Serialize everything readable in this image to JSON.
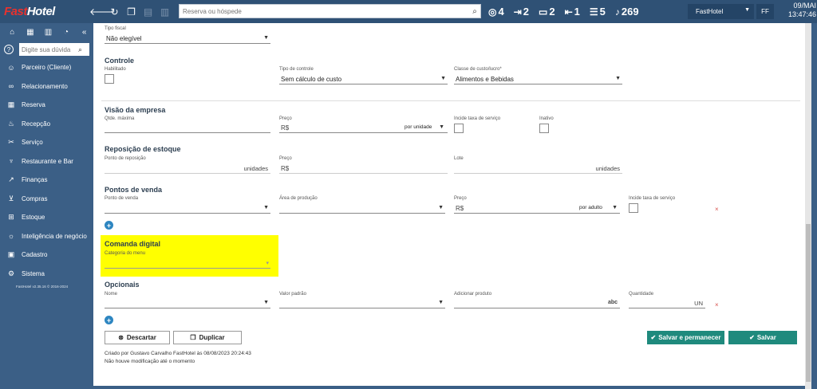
{
  "app": {
    "logo_part1": "Fast",
    "logo_part2": "Hotel"
  },
  "topbar": {
    "search_placeholder": "Reserva ou hóspede",
    "stats": [
      {
        "icon": "target-icon",
        "glyph": "◎",
        "value": "4"
      },
      {
        "icon": "check-in-icon",
        "glyph": "⇥",
        "value": "2"
      },
      {
        "icon": "bed-icon",
        "glyph": "▭",
        "value": "2"
      },
      {
        "icon": "check-out-icon",
        "glyph": "⇤",
        "value": "1"
      },
      {
        "icon": "list-icon",
        "glyph": "☰",
        "value": "5"
      },
      {
        "icon": "bell-icon",
        "glyph": "♪",
        "value": "269"
      }
    ],
    "hotel": "FastHotel",
    "user_initials": "FF",
    "date": "09/MAI",
    "time": "13:47:46"
  },
  "sidebar": {
    "help_placeholder": "Digite sua dúvida",
    "items": [
      {
        "name": "Parceiro (Cliente)",
        "icon": "user-icon",
        "glyph": "☺"
      },
      {
        "name": "Relacionamento",
        "icon": "handshake-icon",
        "glyph": "∞"
      },
      {
        "name": "Reserva",
        "icon": "calendar-icon",
        "glyph": "▦"
      },
      {
        "name": "Recepção",
        "icon": "reception-bell-icon",
        "glyph": "♨"
      },
      {
        "name": "Serviço",
        "icon": "wrench-icon",
        "glyph": "✂"
      },
      {
        "name": "Restaurante e Bar",
        "icon": "cutlery-icon",
        "glyph": "♆"
      },
      {
        "name": "Finanças",
        "icon": "chart-icon",
        "glyph": "↗"
      },
      {
        "name": "Compras",
        "icon": "cart-icon",
        "glyph": "⊻"
      },
      {
        "name": "Estoque",
        "icon": "box-icon",
        "glyph": "⊞"
      },
      {
        "name": "Inteligência de negócio",
        "icon": "bulb-icon",
        "glyph": "☼"
      },
      {
        "name": "Cadastro",
        "icon": "card-icon",
        "glyph": "▣"
      },
      {
        "name": "Sistema",
        "icon": "settings-icon",
        "glyph": "⚙"
      }
    ],
    "version": "FastHotel v2.35.16 © 2016-2024"
  },
  "form": {
    "tipo_fiscal": {
      "label": "Tipo fiscal",
      "value": "Não elegível"
    },
    "controle": {
      "title": "Controle",
      "habilitado_label": "Habilitado",
      "tipo_controle": {
        "label": "Tipo de controle",
        "value": "Sem cálculo de custo"
      },
      "classe": {
        "label": "Classe de custo/lucro*",
        "value": "Alimentos e Bebidas"
      }
    },
    "visao": {
      "title": "Visão da empresa",
      "qtde_label": "Qtde. máxima",
      "preco_label": "Preço",
      "preco_prefix": "R$",
      "preco_unit": "por unidade",
      "incide_label": "Incide taxa de serviço",
      "inativo_label": "Inativo"
    },
    "reposicao": {
      "title": "Reposição de estoque",
      "ponto_label": "Ponto de reposição",
      "ponto_suffix": "unidades",
      "preco_label": "Preço",
      "preco_prefix": "R$",
      "lote_label": "Lote",
      "lote_suffix": "unidades"
    },
    "pontos": {
      "title": "Pontos de venda",
      "ponto_label": "Ponto de venda",
      "area_label": "Área de produção",
      "preco_label": "Preço",
      "preco_prefix": "R$",
      "preco_unit": "por adulto",
      "incide_label": "Incide taxa de serviço",
      "remove": "×"
    },
    "comanda": {
      "title": "Comanda digital",
      "categoria_label": "Categoria do menu"
    },
    "opcionais": {
      "title": "Opcionais",
      "nome_label": "Nome",
      "valor_label": "Valor padrão",
      "adicionar_label": "Adicionar produto",
      "adicionar_suffix": "abc",
      "quantidade_label": "Quantidade",
      "quantidade_suffix": "UN",
      "remove": "×"
    }
  },
  "buttons": {
    "descartar": "Descartar",
    "duplicar": "Duplicar",
    "salvar_permanecer": "Salvar e permanecer",
    "salvar": "Salvar"
  },
  "footer": {
    "created": "Criado por Gustavo Carvalho FastHotel às 08/08/2023 20:24:43",
    "modified": "Não houve modificação até o momento"
  }
}
